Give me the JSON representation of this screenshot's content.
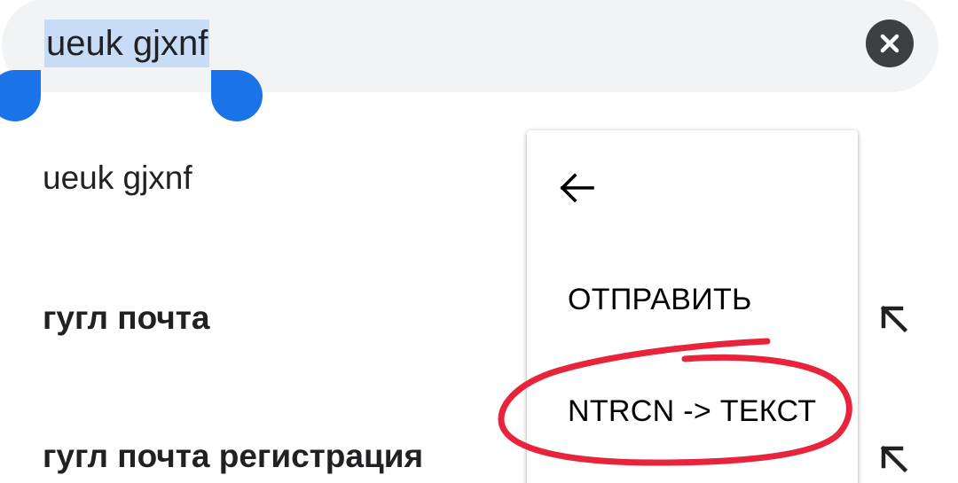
{
  "search": {
    "query": "ueuk gjxnf",
    "clear_icon": "close-circle-icon"
  },
  "suggestions": [
    {
      "text": "ueuk gjxnf",
      "bold": false
    },
    {
      "text": "гугл почта",
      "bold": true,
      "action_icon": "arrow-up-left-icon"
    },
    {
      "text": "гугл почта регистрация",
      "bold": true,
      "action_icon": "arrow-up-left-icon"
    }
  ],
  "popup_menu": {
    "back_icon": "arrow-left-icon",
    "items": [
      "ОТПРАВИТЬ",
      "NTRCN -> ТЕКСТ"
    ]
  },
  "colors": {
    "search_bg": "#f1f3f4",
    "selection_highlight": "#c9dcf6",
    "selection_handle": "#1a73e8",
    "annotation_red": "#e8243c"
  }
}
